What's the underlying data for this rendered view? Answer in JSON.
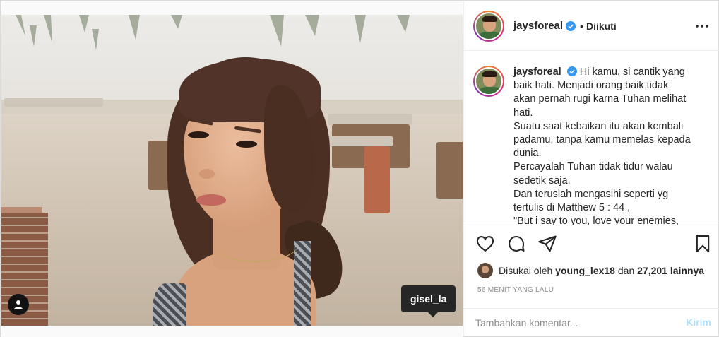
{
  "post": {
    "photo_tag_username": "gisel_la",
    "user_tag_icon": "person-icon"
  },
  "header": {
    "username": "jaysforeal",
    "separator": "•",
    "follow_state": "Diikuti",
    "verified_icon": "verified-badge-icon",
    "more_icon": "more-horizontal-icon"
  },
  "caption": {
    "username": "jaysforeal",
    "lines": [
      "Hi kamu, si cantik yang",
      "baik hati. Menjadi orang baik tidak",
      "akan pernah rugi karna Tuhan melihat",
      "hati.",
      "Suatu saat kebaikan itu akan kembali",
      "padamu, tanpa kamu memelas kepada",
      "dunia.",
      "Percayalah Tuhan tidak tidur walau",
      "sedetik saja.",
      "Dan teruslah mengasihi seperti yg",
      "tertulis di Matthew 5 : 44 ,",
      "\"But i say to you, love your enemies,"
    ]
  },
  "actions": {
    "like_icon": "heart-icon",
    "comment_icon": "comment-icon",
    "share_icon": "paper-plane-icon",
    "save_icon": "bookmark-icon"
  },
  "likes": {
    "prefix": "Disukai oleh",
    "first_user": "young_lex18",
    "connector": "dan",
    "others": "27,201 lainnya"
  },
  "timestamp": "56 MENIT YANG LALU",
  "comment": {
    "placeholder": "Tambahkan komentar...",
    "post_label": "Kirim"
  },
  "colors": {
    "accent_link": "#0095f6",
    "post_button_disabled": "#b2dffc",
    "verified": "#3897f0",
    "muted_text": "#8e8e8e"
  }
}
